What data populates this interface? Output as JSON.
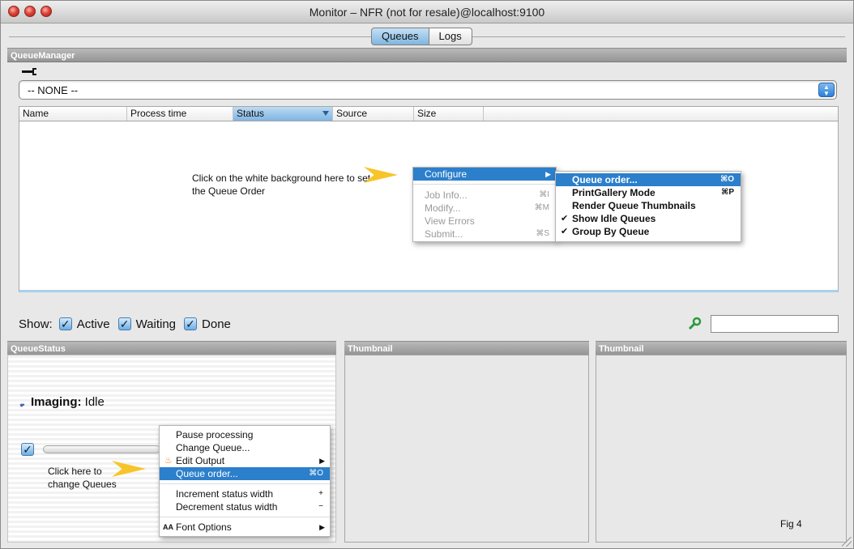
{
  "window": {
    "title": "Monitor – NFR (not for resale)@localhost:9100"
  },
  "tabs": [
    {
      "label": "Queues",
      "active": true
    },
    {
      "label": "Logs",
      "active": false
    }
  ],
  "queue_manager": {
    "header": "QueueManager",
    "selector_value": "-- NONE --",
    "columns": [
      "Name",
      "Process time",
      "Status",
      "Source",
      "Size"
    ],
    "sorted_column": "Status"
  },
  "callouts": {
    "top": "Click on the white background here to set the Queue Order",
    "bottom": "Click here to change Queues"
  },
  "context_menu_left": {
    "items": [
      {
        "label": "Configure",
        "highlighted": true,
        "submenu": true
      },
      {
        "label": "Job Info...",
        "shortcut": "⌘I",
        "disabled": true
      },
      {
        "label": "Modify...",
        "shortcut": "⌘M",
        "disabled": true
      },
      {
        "label": "View Errors",
        "disabled": true
      },
      {
        "label": "Submit...",
        "shortcut": "⌘S",
        "disabled": true
      }
    ]
  },
  "context_menu_right": {
    "items": [
      {
        "label": "Queue order...",
        "shortcut": "⌘O",
        "highlighted": true
      },
      {
        "label": "PrintGallery Mode",
        "shortcut": "⌘P"
      },
      {
        "label": "Render Queue Thumbnails"
      },
      {
        "label": "Show Idle Queues",
        "checked": true
      },
      {
        "label": "Group By Queue",
        "checked": true
      }
    ]
  },
  "show_filters": {
    "label": "Show:",
    "options": [
      {
        "label": "Active",
        "checked": true
      },
      {
        "label": "Waiting",
        "checked": true
      },
      {
        "label": "Done",
        "checked": true
      }
    ]
  },
  "panels": {
    "queue_status": "QueueStatus",
    "thumbnail_1": "Thumbnail",
    "thumbnail_2": "Thumbnail"
  },
  "queue_status": {
    "name": "Imaging:",
    "state": "Idle"
  },
  "queue_menu": {
    "items": [
      {
        "label": "Pause processing"
      },
      {
        "label": "Change Queue..."
      },
      {
        "label": "Edit Output",
        "submenu": true
      },
      {
        "label": "Queue order...",
        "shortcut": "⌘O",
        "highlighted": true
      },
      {
        "label": "Increment status width",
        "shortcut": "+"
      },
      {
        "label": "Decrement status width",
        "shortcut": "−"
      },
      {
        "label": "Font Options",
        "icon": "AA",
        "submenu": true
      }
    ]
  },
  "figure_label": "Fig 4",
  "colors": {
    "accent": "#2b7fcb",
    "callout_arrow": "#f7c42a",
    "panel_header": "#a3a3a3"
  },
  "icons": [
    "wrench-icon",
    "magnifier-icon",
    "chevron-right-icon",
    "checkmark-icon",
    "flame-icon",
    "font-icon"
  ]
}
